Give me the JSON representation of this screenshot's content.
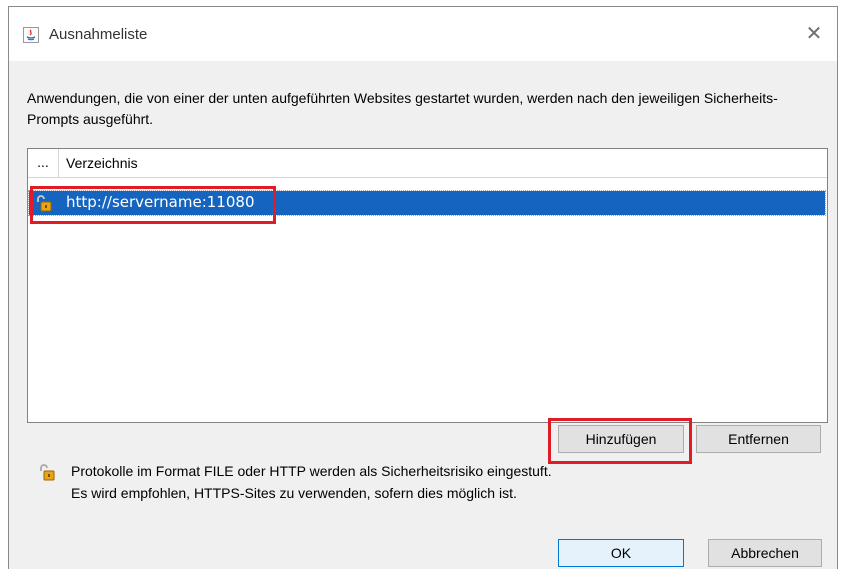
{
  "window": {
    "title": "Ausnahmeliste",
    "close_glyph": "✕"
  },
  "description": "Anwendungen, die von einer der unten aufgeführten Websites gestartet wurden, werden nach den jeweiligen Sicherheits-Prompts ausgeführt.",
  "table": {
    "columns": [
      "...",
      "Verzeichnis"
    ],
    "rows": [
      {
        "icon": "unlocked-padlock-icon",
        "url": "http://servername:11080",
        "selected": true
      }
    ]
  },
  "buttons": {
    "add": "Hinzufügen",
    "remove": "Entfernen",
    "ok": "OK",
    "cancel": "Abbrechen"
  },
  "warning": {
    "icon": "unlocked-padlock-icon",
    "line1": "Protokolle im Format FILE oder HTTP werden als Sicherheitsrisiko eingestuft.",
    "line2": "Es wird empfohlen, HTTPS-Sites zu verwenden, sofern dies möglich ist."
  },
  "colors": {
    "selection": "#1565c0",
    "highlight": "#e01c24",
    "dialog_bg": "#f0f0f0"
  }
}
